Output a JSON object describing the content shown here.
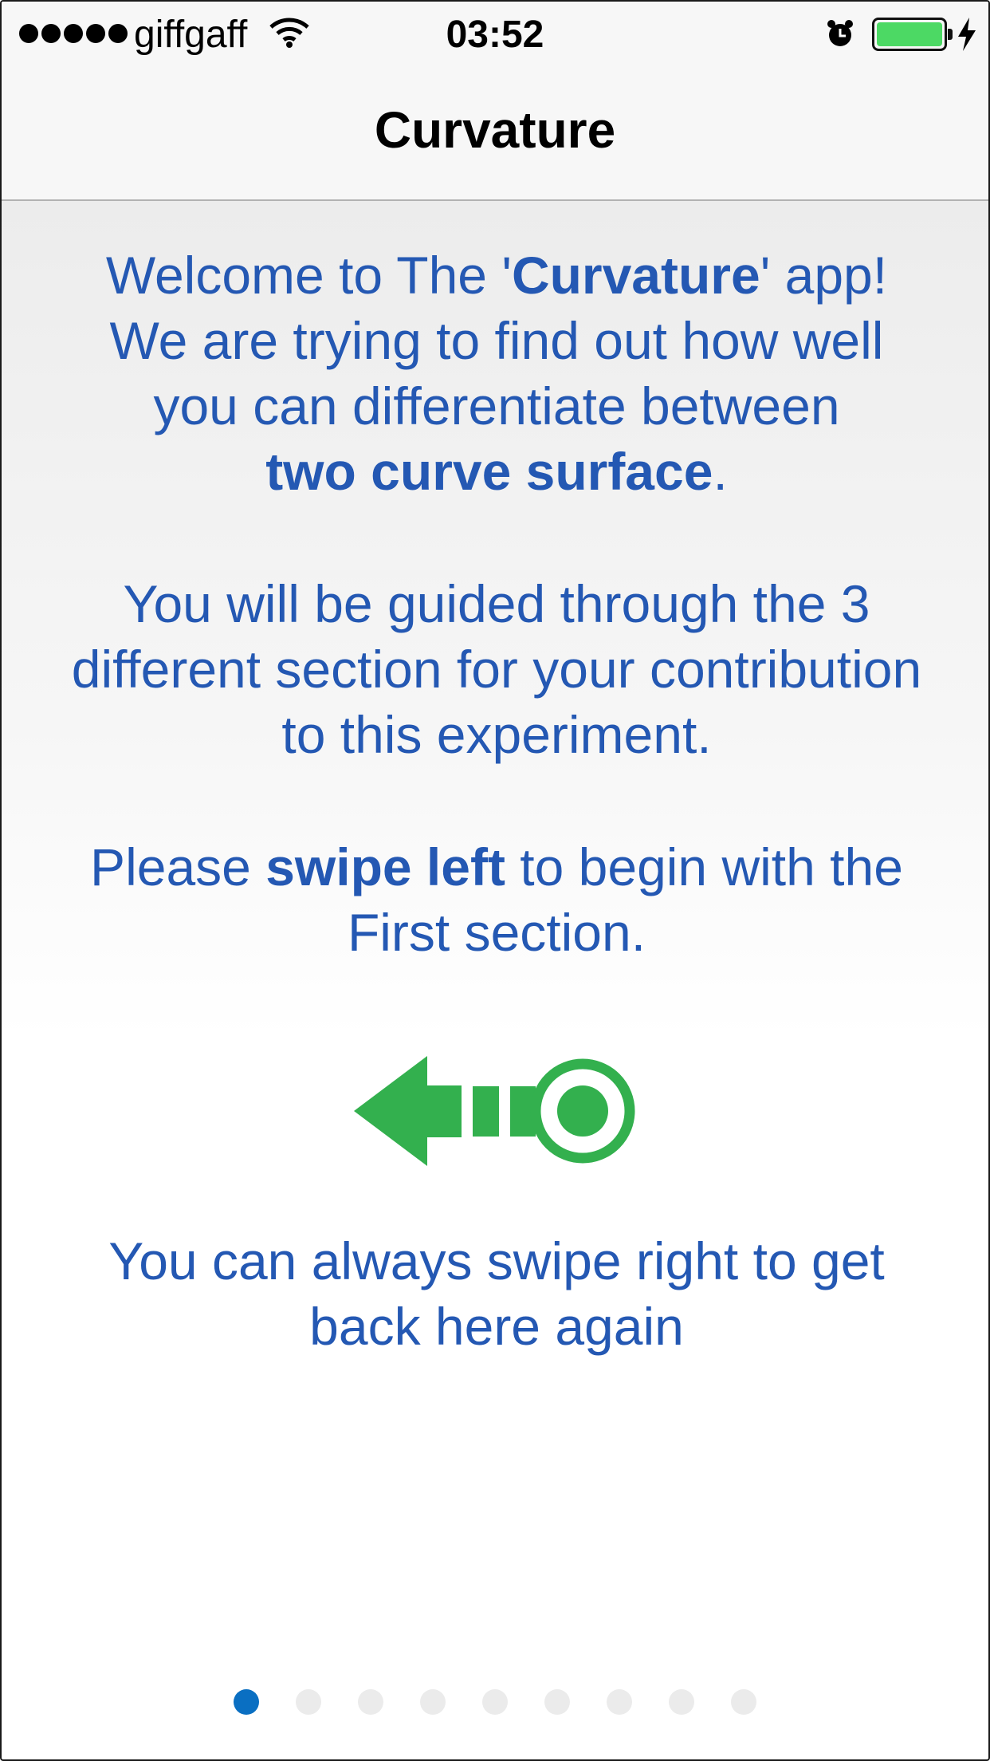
{
  "status_bar": {
    "carrier": "giffgaff",
    "signal_bars": 5,
    "time": "03:52",
    "battery_level": 1.0,
    "charging": true
  },
  "nav": {
    "title": "Curvature"
  },
  "content": {
    "p1_l1_a": "Welcome to The '",
    "p1_l1_b": "Curvature",
    "p1_l1_c": "' app!",
    "p1_l2": "We are trying to find out how well",
    "p1_l3": "you can differentiate between",
    "p1_l4_a": "two curve surface",
    "p1_l4_b": ".",
    "p2_l1": "You will be guided through the 3",
    "p2_l2": "different section for your contribution",
    "p2_l3": "to this experiment.",
    "p3_l1_a": "Please ",
    "p3_l1_b": "swipe left",
    "p3_l1_c": " to begin with the",
    "p3_l2": "First section.",
    "p4_l1": "You can always swipe right to get",
    "p4_l2": "back here again"
  },
  "swipe_icon": "swipe-left-icon",
  "pager": {
    "total": 9,
    "current": 1
  },
  "colors": {
    "text": "#2458b3",
    "icon": "#33b04e",
    "dot_active": "#0a6fc2",
    "dot_inactive": "#ebebeb"
  }
}
